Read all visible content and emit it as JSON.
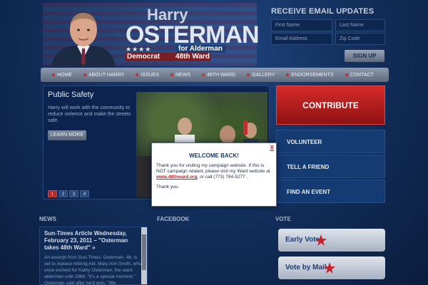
{
  "header": {
    "first_name": "Harry",
    "last_name": "OSTERMAN",
    "stars": "★★★★",
    "for_alderman": "for Alderman",
    "party": "Democrat",
    "ward": "48th Ward"
  },
  "email_signup": {
    "title": "Receive Email Updates",
    "first_name_placeholder": "First Name",
    "last_name_placeholder": "Last Name",
    "email_placeholder": "Email Address",
    "zip_placeholder": "Zip Code",
    "signup_label": "SIGN UP"
  },
  "nav": {
    "items": [
      {
        "label": "HOME"
      },
      {
        "label": "ABOUT HARRY"
      },
      {
        "label": "ISSUES"
      },
      {
        "label": "NEWS"
      },
      {
        "label": "48th WARD"
      },
      {
        "label": "GALLERY"
      },
      {
        "label": "ENDORSEMENTS"
      },
      {
        "label": "CONTACT"
      }
    ]
  },
  "slider": {
    "title": "Public Safety",
    "body": "Harry will work with the community to reduce violence and make the streets safe.",
    "learn_more": "LEARN MORE",
    "pages": [
      "1",
      "2",
      "3",
      "4"
    ],
    "active_page": "1"
  },
  "actions": {
    "contribute": "CONTRIBUTE",
    "volunteer": "VOLUNTEER",
    "tell_friend": "TELL A FRIEND",
    "find_event": "FIND AN EVENT"
  },
  "sections": {
    "news": "NEWS",
    "facebook": "FACEBOOK",
    "vote": "VOTE"
  },
  "news": {
    "headline": "Sun-Times Article Wednesday, February 23, 2011 – \"Osterman takes 48th Ward\" »",
    "body": "An excerpt from Sun-Times: Osterman, 48, is set to replace retiring Ald. Mary Ann Smith, who once worked for Kathy Osterman, the ward alderman until 1986. \"It's a special moment,\" Osterman said after he'd won. \"We"
  },
  "vote": {
    "early": "Early Vote",
    "mail": "Vote by Mail"
  },
  "modal": {
    "close": "X",
    "title": "WELCOME BACK!",
    "body_before": "Thank you for visiting my campaign website.  If this is NOT campaign related, please visit my Ward website at",
    "link": "www.48thward.org",
    "body_after": ", or call   (773) 784-5277  .",
    "thanks": "Thank you."
  },
  "colors": {
    "background": "#13305e",
    "contribute": "#c21f1f",
    "accent_red": "#c81e1e",
    "action_blue": "#143b72"
  }
}
